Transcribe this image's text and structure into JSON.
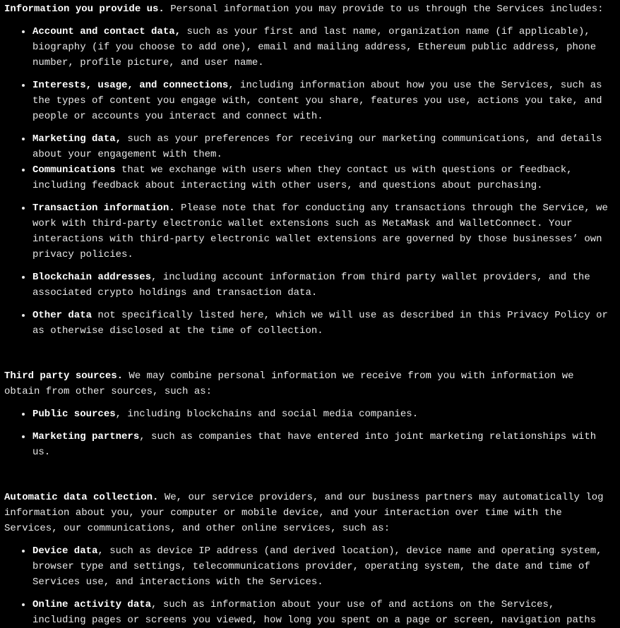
{
  "sections": [
    {
      "heading": "Information you provide us.",
      "intro": " Personal information you may provide to us through the Services includes:",
      "items": [
        {
          "term": "Account and contact data,",
          "text": " such as your first and last name, organization name (if applicable), biography (if you choose to add one), email and mailing address, Ethereum public address, phone number, profile picture, and user name."
        },
        {
          "term": "Interests, usage, and connections",
          "text": ", including information about how you use the Services, such as the types of content you engage with, content you share, features you use, actions you take, and people or accounts you interact and connect with."
        },
        {
          "term": "Marketing data,",
          "text": " such as your preferences for receiving our marketing communications, and details about your engagement with them."
        },
        {
          "term": "Communications",
          "text": " that we exchange with users when they contact us with questions or feedback, including feedback about interacting with other users, and questions about purchasing."
        },
        {
          "term": "Transaction information.",
          "text": " Please note that for conducting any transactions through the Service, we work with third-party electronic wallet extensions such as MetaMask and WalletConnect. Your interactions with third-party electronic wallet extensions are governed by those businesses’ own privacy policies."
        },
        {
          "term": "Blockchain addresses",
          "text": ", including account information from third party wallet providers, and the associated crypto holdings and transaction data."
        },
        {
          "term": "Other data",
          "text": " not specifically listed here, which we will use as described in this Privacy Policy or as otherwise disclosed at the time of collection."
        }
      ]
    },
    {
      "heading": "Third party sources.",
      "intro": " We may combine personal information we receive from you with information we obtain from other sources, such as:",
      "items": [
        {
          "term": "Public sources",
          "text": ", including blockchains and social media companies."
        },
        {
          "term": "Marketing partners",
          "text": ", such as companies that have entered into joint marketing relationships with us."
        }
      ]
    },
    {
      "heading": "Automatic data collection.",
      "intro": " We, our service providers, and our business partners may automatically log information about you, your computer or mobile device, and your interaction over time with the Services, our communications, and other online services, such as:",
      "items": [
        {
          "term": "Device data",
          "text": ", such as device IP address (and derived location), device name and operating system, browser type and settings, telecommunications provider, operating system, the date and time of Services use, and interactions with the Services."
        },
        {
          "term": "Online activity data",
          "text": ", such as information about your use of and actions on the Services, including pages or screens you viewed, how long you spent on a page or screen, navigation paths"
        }
      ]
    }
  ]
}
